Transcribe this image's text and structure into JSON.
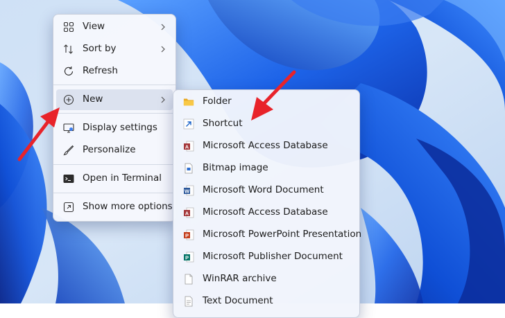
{
  "context_menu": {
    "items": [
      {
        "label": "View",
        "icon": "view-grid-icon",
        "submenu": true
      },
      {
        "label": "Sort by",
        "icon": "sort-icon",
        "submenu": true
      },
      {
        "label": "Refresh",
        "icon": "refresh-icon",
        "submenu": false
      },
      {
        "label": "New",
        "icon": "new-plus-icon",
        "submenu": true,
        "highlighted": true
      },
      {
        "label": "Display settings",
        "icon": "display-icon",
        "submenu": false
      },
      {
        "label": "Personalize",
        "icon": "brush-icon",
        "submenu": false
      },
      {
        "label": "Open in Terminal",
        "icon": "terminal-icon",
        "submenu": false
      },
      {
        "label": "Show more options",
        "icon": "more-options-icon",
        "submenu": false
      }
    ]
  },
  "new_submenu": {
    "items": [
      {
        "label": "Folder",
        "icon": "folder-icon"
      },
      {
        "label": "Shortcut",
        "icon": "shortcut-icon"
      },
      {
        "label": "Microsoft Access Database",
        "icon": "access-icon"
      },
      {
        "label": "Bitmap image",
        "icon": "bitmap-icon"
      },
      {
        "label": "Microsoft Word Document",
        "icon": "word-icon"
      },
      {
        "label": "Microsoft Access Database",
        "icon": "access-icon"
      },
      {
        "label": "Microsoft PowerPoint Presentation",
        "icon": "powerpoint-icon"
      },
      {
        "label": "Microsoft Publisher Document",
        "icon": "publisher-icon"
      },
      {
        "label": "WinRAR archive",
        "icon": "winrar-icon"
      },
      {
        "label": "Text Document",
        "icon": "text-document-icon"
      }
    ]
  },
  "colors": {
    "arrow": "#e8232a",
    "wallpaper_base": "#1c6bf0",
    "folder": "#f4c244",
    "access": "#a4373a",
    "word": "#2b579a",
    "powerpoint": "#c43e1c",
    "publisher": "#077568"
  }
}
